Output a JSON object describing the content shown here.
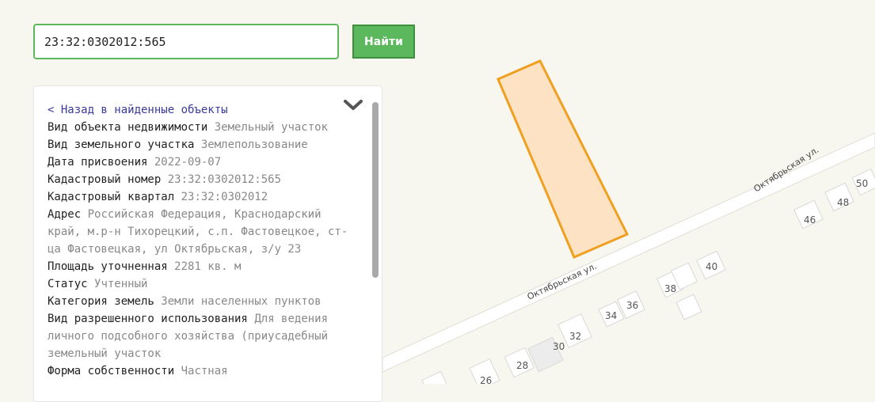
{
  "search": {
    "value": "23:32:0302012:565",
    "button_label": "Найти"
  },
  "panel": {
    "back_link": "< Назад в найденные объекты",
    "fields": [
      {
        "label": "Вид объекта недвижимости",
        "value": "Земельный участок"
      },
      {
        "label": "Вид земельного участка",
        "value": "Землепользование"
      },
      {
        "label": "Дата присвоения",
        "value": "2022-09-07"
      },
      {
        "label": "Кадастровый номер",
        "value": "23:32:0302012:565"
      },
      {
        "label": "Кадастровый квартал",
        "value": "23:32:0302012"
      },
      {
        "label": "Адрес",
        "value": "Российская Федерация, Краснодарский край, м.р-н Тихорецкий, с.п. Фастовецкое, ст-ца Фастовецкая, ул Октябрьская, з/у 23"
      },
      {
        "label": "Площадь уточненная",
        "value": "2281 кв. м"
      },
      {
        "label": "Статус",
        "value": "Учтенный"
      },
      {
        "label": "Категория земель",
        "value": "Земли населенных пунктов"
      },
      {
        "label": "Вид разрешенного использования",
        "value": "Для ведения личного подсобного хозяйства (приусадебный земельный участок"
      },
      {
        "label": "Форма собственности",
        "value": "Частная"
      }
    ]
  },
  "map": {
    "street_labels": [
      "Октябрьская ул.",
      "Октябрьская ул."
    ],
    "house_numbers": [
      "26",
      "28",
      "30",
      "32",
      "34",
      "36",
      "38",
      "40",
      "46",
      "48",
      "50"
    ],
    "parcel_stroke": "#f0a020",
    "parcel_fill": "#fde3c4"
  }
}
